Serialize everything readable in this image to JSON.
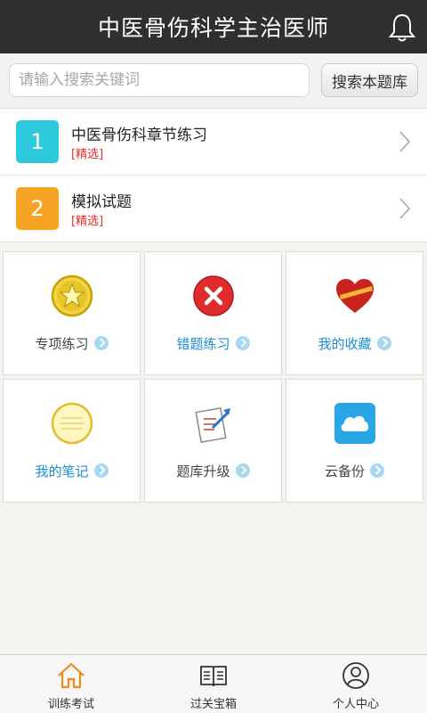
{
  "header": {
    "title": "中医骨伤科学主治医师"
  },
  "search": {
    "placeholder": "请输入搜索关键词",
    "button_label": "搜索本题库"
  },
  "chapters": [
    {
      "number": "1",
      "name": "中医骨伤科章节练习",
      "tag": "[精选]",
      "color": "#2ec9dc"
    },
    {
      "number": "2",
      "name": "模拟试题",
      "tag": "[精选]",
      "color": "#f7a425"
    }
  ],
  "grid": [
    {
      "label": "专项练习",
      "icon": "star-badge-icon"
    },
    {
      "label": "错题练习",
      "icon": "red-x-icon"
    },
    {
      "label": "我的收藏",
      "icon": "heart-icon"
    },
    {
      "label": "我的笔记",
      "icon": "notepad-icon"
    },
    {
      "label": "题库升级",
      "icon": "upgrade-document-icon"
    },
    {
      "label": "云备份",
      "icon": "cloud-icon"
    }
  ],
  "tabbar": [
    {
      "label": "训练考试",
      "icon": "home-icon",
      "active": true
    },
    {
      "label": "过关宝箱",
      "icon": "book-icon",
      "active": false
    },
    {
      "label": "个人中心",
      "icon": "person-icon",
      "active": false
    }
  ],
  "colors": {
    "header_bg": "#2f2f2f",
    "link_blue": "#1a8fd6",
    "tag_red": "#e42a2a",
    "active_tab": "#f08a1a"
  }
}
